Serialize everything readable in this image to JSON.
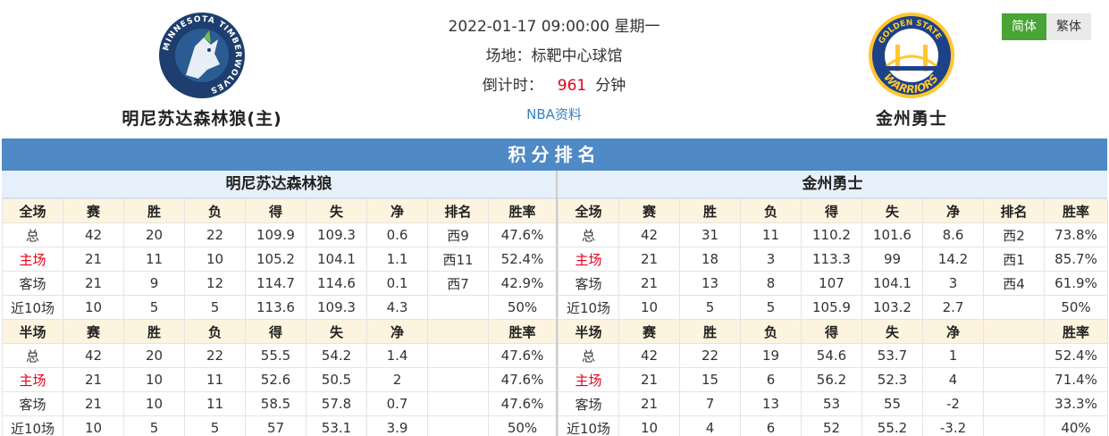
{
  "home_team": {
    "name": "明尼苏达森林狼(主)",
    "short_name": "明尼苏达森林狼",
    "logo_text": "MINNESOTA TIMBERWOLVES"
  },
  "away_team": {
    "name": "金州勇士",
    "short_name": "金州勇士",
    "logo_text_top": "GOLDEN STATE",
    "logo_text_bottom": "WARRIORS"
  },
  "match": {
    "datetime": "2022-01-17 09:00:00 星期一",
    "venue": "场地：标靶中心球馆",
    "countdown_label": "倒计时：",
    "countdown_value": "961",
    "countdown_unit": "分钟",
    "nba_link": "NBA资料"
  },
  "lang": {
    "simplified": "简体",
    "traditional": "繁体"
  },
  "section_title": "积分排名",
  "colors": {
    "header_blue": "#4f89c6",
    "home_red": "#e4001b",
    "active_green": "#48a435"
  },
  "standings": {
    "home": [
      [
        "全场",
        "赛",
        "胜",
        "负",
        "得",
        "失",
        "净",
        "排名",
        "胜率"
      ],
      [
        "总",
        "42",
        "20",
        "22",
        "109.9",
        "109.3",
        "0.6",
        "西9",
        "47.6%"
      ],
      [
        "主场",
        "21",
        "11",
        "10",
        "105.2",
        "104.1",
        "1.1",
        "西11",
        "52.4%"
      ],
      [
        "客场",
        "21",
        "9",
        "12",
        "114.7",
        "114.6",
        "0.1",
        "西7",
        "42.9%"
      ],
      [
        "近10场",
        "10",
        "5",
        "5",
        "113.6",
        "109.3",
        "4.3",
        "",
        "50%"
      ],
      [
        "半场",
        "赛",
        "胜",
        "负",
        "得",
        "失",
        "净",
        "",
        "胜率"
      ],
      [
        "总",
        "42",
        "20",
        "22",
        "55.5",
        "54.2",
        "1.4",
        "",
        "47.6%"
      ],
      [
        "主场",
        "21",
        "10",
        "11",
        "52.6",
        "50.5",
        "2",
        "",
        "47.6%"
      ],
      [
        "客场",
        "21",
        "10",
        "11",
        "58.5",
        "57.8",
        "0.7",
        "",
        "47.6%"
      ],
      [
        "近10场",
        "10",
        "5",
        "5",
        "57",
        "53.1",
        "3.9",
        "",
        "50%"
      ]
    ],
    "away": [
      [
        "全场",
        "赛",
        "胜",
        "负",
        "得",
        "失",
        "净",
        "排名",
        "胜率"
      ],
      [
        "总",
        "42",
        "31",
        "11",
        "110.2",
        "101.6",
        "8.6",
        "西2",
        "73.8%"
      ],
      [
        "主场",
        "21",
        "18",
        "3",
        "113.3",
        "99",
        "14.2",
        "西1",
        "85.7%"
      ],
      [
        "客场",
        "21",
        "13",
        "8",
        "107",
        "104.1",
        "3",
        "西4",
        "61.9%"
      ],
      [
        "近10场",
        "10",
        "5",
        "5",
        "105.9",
        "103.2",
        "2.7",
        "",
        "50%"
      ],
      [
        "半场",
        "赛",
        "胜",
        "负",
        "得",
        "失",
        "净",
        "",
        "胜率"
      ],
      [
        "总",
        "42",
        "22",
        "19",
        "54.6",
        "53.7",
        "1",
        "",
        "52.4%"
      ],
      [
        "主场",
        "21",
        "15",
        "6",
        "56.2",
        "52.3",
        "4",
        "",
        "71.4%"
      ],
      [
        "客场",
        "21",
        "7",
        "13",
        "53",
        "55",
        "-2",
        "",
        "33.3%"
      ],
      [
        "近10场",
        "10",
        "4",
        "6",
        "52",
        "55.2",
        "-3.2",
        "",
        "40%"
      ]
    ]
  }
}
